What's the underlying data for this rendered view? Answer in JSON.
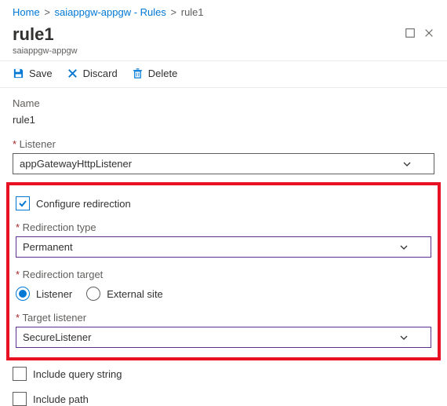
{
  "breadcrumb": {
    "home": "Home",
    "rules": "saiappgw-appgw - Rules",
    "current": "rule1"
  },
  "header": {
    "title": "rule1",
    "subtitle": "saiappgw-appgw"
  },
  "toolbar": {
    "save": "Save",
    "discard": "Discard",
    "delete": "Delete"
  },
  "form": {
    "name_label": "Name",
    "name_value": "rule1",
    "listener_label": "Listener",
    "listener_value": "appGatewayHttpListener",
    "configure_redirection": "Configure redirection",
    "redirection_type_label": "Redirection type",
    "redirection_type_value": "Permanent",
    "redirection_target_label": "Redirection target",
    "radio_listener": "Listener",
    "radio_external": "External site",
    "target_listener_label": "Target listener",
    "target_listener_value": "SecureListener",
    "include_query": "Include query string",
    "include_path": "Include path"
  }
}
